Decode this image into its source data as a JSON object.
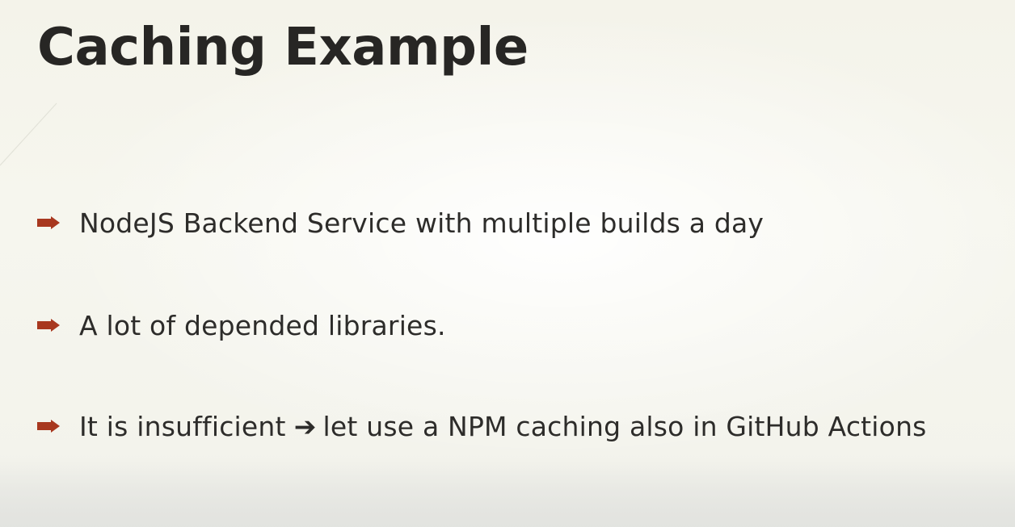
{
  "slide": {
    "title": "Caching Example",
    "bullets": [
      {
        "text": "NodeJS Backend Service with multiple builds a day"
      },
      {
        "text": "A lot of depended libraries."
      },
      {
        "text_before": "It is insufficient",
        "arrow": "➔",
        "text_after": "let use a NPM caching also in GitHub Actions"
      }
    ],
    "accent_color": "#a8381f",
    "bullet_icon": "arrow-bullet-icon"
  }
}
